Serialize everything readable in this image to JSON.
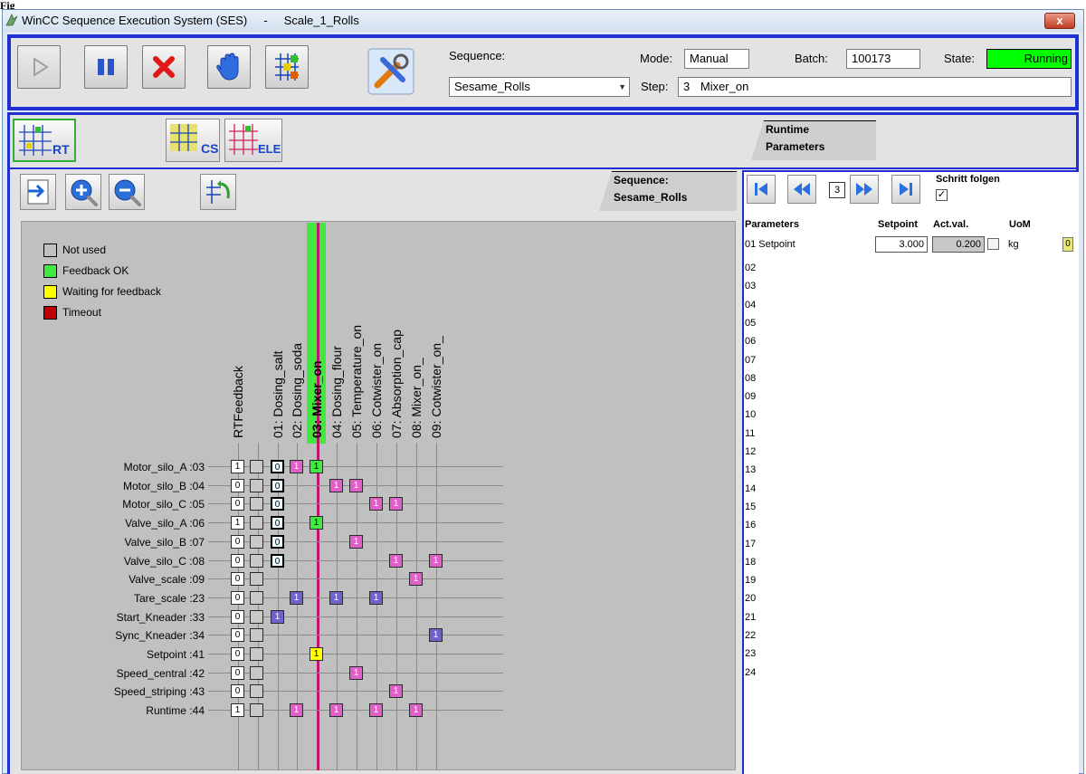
{
  "figure_label": "Fig",
  "window": {
    "title": "WinCC Sequence Execution System (SES)     -     Scale_1_Rolls",
    "close_label": "x"
  },
  "header": {
    "sequence_label": "Sequence:",
    "sequence_value": "Sesame_Rolls",
    "mode_label": "Mode:",
    "mode_value": "Manual",
    "batch_label": "Batch:",
    "batch_value": "100173",
    "state_label": "State:",
    "state_value": "Running",
    "step_label": "Step:",
    "step_number": "3",
    "step_name": "Mixer_on"
  },
  "view_tabs": {
    "rt": "RT",
    "cs": "CS",
    "ele": "ELE",
    "runtime_parameters_line1": "Runtime",
    "runtime_parameters_line2": "Parameters"
  },
  "sequence_tab": {
    "line1": "Sequence:",
    "line2": "Sesame_Rolls"
  },
  "legend": [
    {
      "label": "Not used",
      "color": "#c0c0c0"
    },
    {
      "label": "Feedback OK",
      "color": "#40e840"
    },
    {
      "label": "Waiting for feedback",
      "color": "#ffff00"
    },
    {
      "label": "Timeout",
      "color": "#c00000"
    }
  ],
  "columns": [
    "RTFeedback",
    "01: Dosing_salt",
    "02: Dosing_soda",
    "03: Mixer_on",
    "04: Dosing_flour",
    "05: Temperature_on",
    "06: Cotwister_on",
    "07: Absorption_cap",
    "08: Mixer_on_",
    "09: Cotwister_on_"
  ],
  "rows": [
    {
      "label": "Motor_silo_A :03",
      "rt": "1"
    },
    {
      "label": "Motor_silo_B :04",
      "rt": "0"
    },
    {
      "label": "Motor_silo_C :05",
      "rt": "0"
    },
    {
      "label": "Valve_silo_A :06",
      "rt": "1"
    },
    {
      "label": "Valve_silo_B :07",
      "rt": "0"
    },
    {
      "label": "Valve_silo_C :08",
      "rt": "0"
    },
    {
      "label": "Valve_scale :09",
      "rt": "0"
    },
    {
      "label": "Tare_scale :23",
      "rt": "0"
    },
    {
      "label": "Start_Kneader :33",
      "rt": "0"
    },
    {
      "label": "Sync_Kneader :34",
      "rt": "0"
    },
    {
      "label": "Setpoint :41",
      "rt": "0"
    },
    {
      "label": "Speed_central :42",
      "rt": "0"
    },
    {
      "label": "Speed_striping :43",
      "rt": "0"
    },
    {
      "label": "Runtime :44",
      "rt": "1"
    }
  ],
  "cells": [
    {
      "row": 0,
      "col": 1,
      "value": "0",
      "color": "cyan"
    },
    {
      "row": 0,
      "col": 2,
      "value": "1",
      "color": "pink"
    },
    {
      "row": 0,
      "col": 3,
      "value": "1",
      "color": "green"
    },
    {
      "row": 1,
      "col": 1,
      "value": "0",
      "color": "cyan"
    },
    {
      "row": 1,
      "col": 4,
      "value": "1",
      "color": "pink"
    },
    {
      "row": 1,
      "col": 5,
      "value": "1",
      "color": "pink"
    },
    {
      "row": 2,
      "col": 1,
      "value": "0",
      "color": "cyan"
    },
    {
      "row": 2,
      "col": 6,
      "value": "1",
      "color": "pink"
    },
    {
      "row": 2,
      "col": 7,
      "value": "1",
      "color": "pink"
    },
    {
      "row": 3,
      "col": 1,
      "value": "0",
      "color": "cyan"
    },
    {
      "row": 3,
      "col": 3,
      "value": "1",
      "color": "green"
    },
    {
      "row": 4,
      "col": 1,
      "value": "0",
      "color": "cyan"
    },
    {
      "row": 4,
      "col": 5,
      "value": "1",
      "color": "pink"
    },
    {
      "row": 5,
      "col": 1,
      "value": "0",
      "color": "cyan"
    },
    {
      "row": 5,
      "col": 7,
      "value": "1",
      "color": "pink"
    },
    {
      "row": 5,
      "col": 9,
      "value": "1",
      "color": "pink"
    },
    {
      "row": 6,
      "col": 8,
      "value": "1",
      "color": "pink"
    },
    {
      "row": 7,
      "col": 2,
      "value": "1",
      "color": "blue"
    },
    {
      "row": 7,
      "col": 4,
      "value": "1",
      "color": "blue"
    },
    {
      "row": 7,
      "col": 6,
      "value": "1",
      "color": "blue"
    },
    {
      "row": 8,
      "col": 1,
      "value": "1",
      "color": "blue"
    },
    {
      "row": 9,
      "col": 9,
      "value": "1",
      "color": "blue"
    },
    {
      "row": 10,
      "col": 3,
      "value": "1",
      "color": "yellow"
    },
    {
      "row": 11,
      "col": 5,
      "value": "1",
      "color": "pink"
    },
    {
      "row": 12,
      "col": 7,
      "value": "1",
      "color": "pink"
    },
    {
      "row": 13,
      "col": 2,
      "value": "1",
      "color": "pink"
    },
    {
      "row": 13,
      "col": 4,
      "value": "1",
      "color": "pink"
    },
    {
      "row": 13,
      "col": 6,
      "value": "1",
      "color": "pink"
    },
    {
      "row": 13,
      "col": 8,
      "value": "1",
      "color": "pink"
    }
  ],
  "active_column": 3,
  "params": {
    "step_number": "3",
    "follow_label": "Schritt folgen",
    "follow_checked": true,
    "headers": {
      "name": "Parameters",
      "setpoint": "Setpoint",
      "actual": "Act.val.",
      "uom": "UoM"
    },
    "first": {
      "name": "01 Setpoint",
      "setpoint": "3.000",
      "actual": "0.200",
      "uom": "kg",
      "flag": "0"
    },
    "numbers": [
      "02",
      "03",
      "04",
      "05",
      "06",
      "07",
      "08",
      "09",
      "10",
      "11",
      "12",
      "13",
      "14",
      "15",
      "16",
      "17",
      "18",
      "19",
      "20",
      "21",
      "22",
      "23",
      "24"
    ]
  },
  "colors": {
    "frame_blue": "#1f2fd0",
    "state_green": "#00ff00",
    "active_column": "#40e840",
    "active_line": "#c0146e"
  }
}
